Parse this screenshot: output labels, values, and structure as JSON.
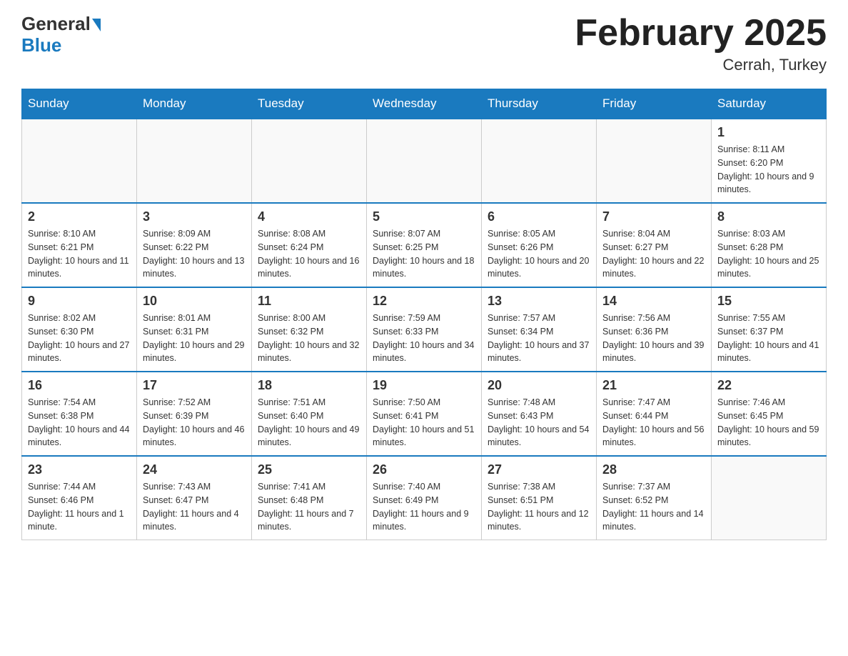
{
  "logo": {
    "general": "General",
    "blue": "Blue"
  },
  "header": {
    "title": "February 2025",
    "location": "Cerrah, Turkey"
  },
  "weekdays": [
    "Sunday",
    "Monday",
    "Tuesday",
    "Wednesday",
    "Thursday",
    "Friday",
    "Saturday"
  ],
  "weeks": [
    [
      {
        "day": "",
        "info": ""
      },
      {
        "day": "",
        "info": ""
      },
      {
        "day": "",
        "info": ""
      },
      {
        "day": "",
        "info": ""
      },
      {
        "day": "",
        "info": ""
      },
      {
        "day": "",
        "info": ""
      },
      {
        "day": "1",
        "info": "Sunrise: 8:11 AM\nSunset: 6:20 PM\nDaylight: 10 hours and 9 minutes."
      }
    ],
    [
      {
        "day": "2",
        "info": "Sunrise: 8:10 AM\nSunset: 6:21 PM\nDaylight: 10 hours and 11 minutes."
      },
      {
        "day": "3",
        "info": "Sunrise: 8:09 AM\nSunset: 6:22 PM\nDaylight: 10 hours and 13 minutes."
      },
      {
        "day": "4",
        "info": "Sunrise: 8:08 AM\nSunset: 6:24 PM\nDaylight: 10 hours and 16 minutes."
      },
      {
        "day": "5",
        "info": "Sunrise: 8:07 AM\nSunset: 6:25 PM\nDaylight: 10 hours and 18 minutes."
      },
      {
        "day": "6",
        "info": "Sunrise: 8:05 AM\nSunset: 6:26 PM\nDaylight: 10 hours and 20 minutes."
      },
      {
        "day": "7",
        "info": "Sunrise: 8:04 AM\nSunset: 6:27 PM\nDaylight: 10 hours and 22 minutes."
      },
      {
        "day": "8",
        "info": "Sunrise: 8:03 AM\nSunset: 6:28 PM\nDaylight: 10 hours and 25 minutes."
      }
    ],
    [
      {
        "day": "9",
        "info": "Sunrise: 8:02 AM\nSunset: 6:30 PM\nDaylight: 10 hours and 27 minutes."
      },
      {
        "day": "10",
        "info": "Sunrise: 8:01 AM\nSunset: 6:31 PM\nDaylight: 10 hours and 29 minutes."
      },
      {
        "day": "11",
        "info": "Sunrise: 8:00 AM\nSunset: 6:32 PM\nDaylight: 10 hours and 32 minutes."
      },
      {
        "day": "12",
        "info": "Sunrise: 7:59 AM\nSunset: 6:33 PM\nDaylight: 10 hours and 34 minutes."
      },
      {
        "day": "13",
        "info": "Sunrise: 7:57 AM\nSunset: 6:34 PM\nDaylight: 10 hours and 37 minutes."
      },
      {
        "day": "14",
        "info": "Sunrise: 7:56 AM\nSunset: 6:36 PM\nDaylight: 10 hours and 39 minutes."
      },
      {
        "day": "15",
        "info": "Sunrise: 7:55 AM\nSunset: 6:37 PM\nDaylight: 10 hours and 41 minutes."
      }
    ],
    [
      {
        "day": "16",
        "info": "Sunrise: 7:54 AM\nSunset: 6:38 PM\nDaylight: 10 hours and 44 minutes."
      },
      {
        "day": "17",
        "info": "Sunrise: 7:52 AM\nSunset: 6:39 PM\nDaylight: 10 hours and 46 minutes."
      },
      {
        "day": "18",
        "info": "Sunrise: 7:51 AM\nSunset: 6:40 PM\nDaylight: 10 hours and 49 minutes."
      },
      {
        "day": "19",
        "info": "Sunrise: 7:50 AM\nSunset: 6:41 PM\nDaylight: 10 hours and 51 minutes."
      },
      {
        "day": "20",
        "info": "Sunrise: 7:48 AM\nSunset: 6:43 PM\nDaylight: 10 hours and 54 minutes."
      },
      {
        "day": "21",
        "info": "Sunrise: 7:47 AM\nSunset: 6:44 PM\nDaylight: 10 hours and 56 minutes."
      },
      {
        "day": "22",
        "info": "Sunrise: 7:46 AM\nSunset: 6:45 PM\nDaylight: 10 hours and 59 minutes."
      }
    ],
    [
      {
        "day": "23",
        "info": "Sunrise: 7:44 AM\nSunset: 6:46 PM\nDaylight: 11 hours and 1 minute."
      },
      {
        "day": "24",
        "info": "Sunrise: 7:43 AM\nSunset: 6:47 PM\nDaylight: 11 hours and 4 minutes."
      },
      {
        "day": "25",
        "info": "Sunrise: 7:41 AM\nSunset: 6:48 PM\nDaylight: 11 hours and 7 minutes."
      },
      {
        "day": "26",
        "info": "Sunrise: 7:40 AM\nSunset: 6:49 PM\nDaylight: 11 hours and 9 minutes."
      },
      {
        "day": "27",
        "info": "Sunrise: 7:38 AM\nSunset: 6:51 PM\nDaylight: 11 hours and 12 minutes."
      },
      {
        "day": "28",
        "info": "Sunrise: 7:37 AM\nSunset: 6:52 PM\nDaylight: 11 hours and 14 minutes."
      },
      {
        "day": "",
        "info": ""
      }
    ]
  ]
}
